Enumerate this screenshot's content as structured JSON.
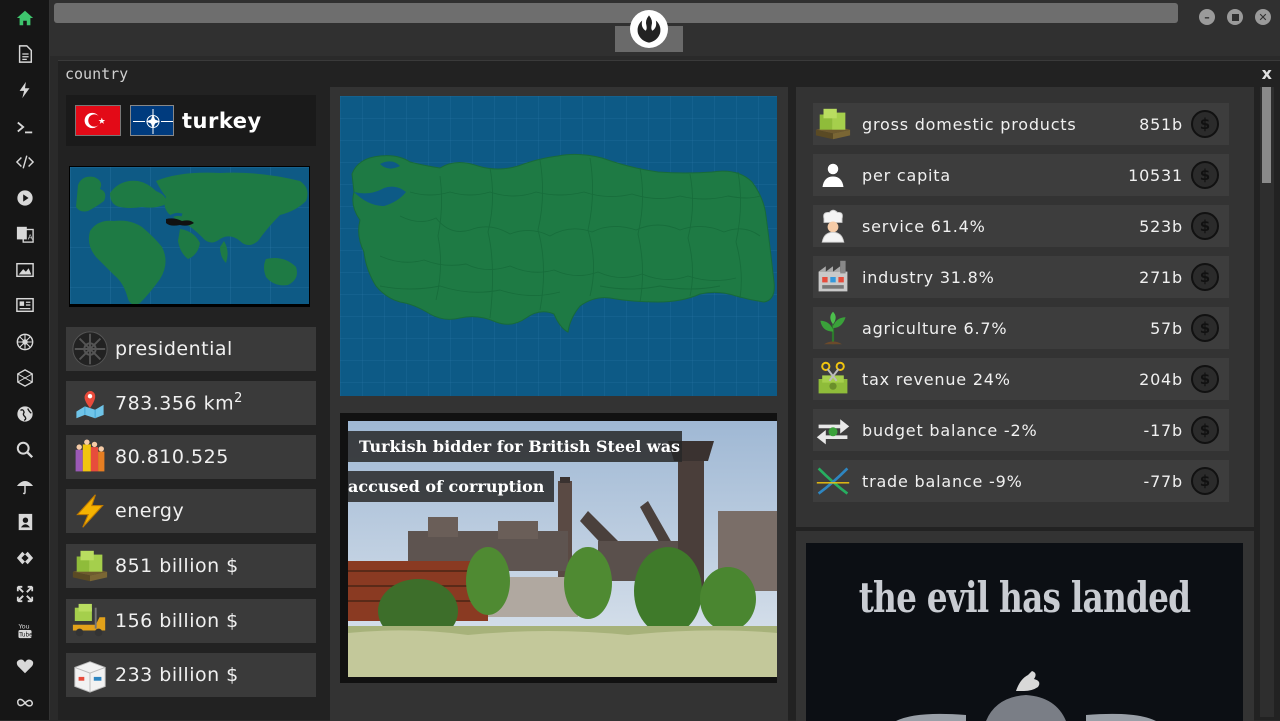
{
  "app": {
    "window_title": "country",
    "close_label": "x"
  },
  "rail": {
    "icons": [
      "home-icon",
      "document-icon",
      "bolt-icon",
      "terminal-icon",
      "code-icon",
      "play-icon",
      "translate-icon",
      "image-icon",
      "news-icon",
      "empire-icon",
      "hexagon-icon",
      "globe-icon",
      "search-icon",
      "umbrella-icon",
      "contacts-icon",
      "diamond-link-icon",
      "expand-icon",
      "youtube-icon",
      "heart-icon",
      "infinity-icon"
    ],
    "youtube_text": "You Tube"
  },
  "country": {
    "name": "turkey",
    "government": "presidential",
    "area": "783.356 km",
    "area_sup": "2",
    "population": "80.810.525",
    "resource": "energy",
    "gdp_text": "851 billion $",
    "exports_text": "156 billion $",
    "imports_text": "233 billion $"
  },
  "news": {
    "headline_line1": "Turkish bidder for British Steel was",
    "headline_line2": "accused of corruption"
  },
  "stats": [
    {
      "label": "gross domestic products",
      "value": "851b",
      "icon": "money-stack-icon"
    },
    {
      "label": "per capita",
      "value": "10531",
      "icon": "person-icon"
    },
    {
      "label": "service 61.4%",
      "value": "523b",
      "icon": "chef-icon"
    },
    {
      "label": "industry 31.8%",
      "value": "271b",
      "icon": "factory-icon"
    },
    {
      "label": "agriculture 6.7%",
      "value": "57b",
      "icon": "plant-icon"
    },
    {
      "label": "tax revenue 24%",
      "value": "204b",
      "icon": "tax-scissors-icon"
    },
    {
      "label": "budget balance -2%",
      "value": "-17b",
      "icon": "balance-arrows-icon"
    },
    {
      "label": "trade balance -9%",
      "value": "-77b",
      "icon": "trade-cross-icon"
    }
  ],
  "dollar_symbol": "$",
  "poster": {
    "text": "the evil has landed"
  },
  "colors": {
    "map_ocean": "#0d5a86",
    "map_land": "#1e7a44",
    "accent_home": "#3ec46d"
  }
}
